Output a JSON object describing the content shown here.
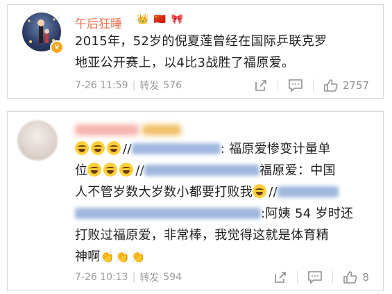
{
  "post": {
    "username": "午后狂睡",
    "badges": [
      "👑",
      "🇨🇳",
      "🎀"
    ],
    "verified_mark": "v",
    "text_line1": "2015年，52岁的倪夏莲曾经在国际乒联克罗",
    "text_line2": "地亚公开赛上，以4比3战胜了福原爱。",
    "time": "7-26 11:59",
    "repost_label": "转发",
    "repost_count": "576",
    "like_count": "2757"
  },
  "comment": {
    "text_part1": ":  福原爱惨变计量单",
    "text_part2": "位",
    "text_part3": "福原爱：中国",
    "text_part4": "人不管岁数大岁数小都要打败我",
    "slash": "//",
    "text_part5": ":阿姨 54 岁时还",
    "text_part6": "打败过福原爱，非常棒，我觉得这就是体育精",
    "text_part7": "神啊",
    "clap": "👏",
    "time": "7-26 10:13",
    "repost_label": "转发",
    "repost_count": "594",
    "like_count": "8"
  },
  "icons": [
    "share-icon",
    "comment-icon",
    "like-icon",
    "laugh-cry-emoji",
    "clap-emoji"
  ],
  "colors": {
    "username": "#eb7350",
    "link": "#507daf",
    "meta": "#9b9b9b",
    "border": "#d8d8d8"
  }
}
